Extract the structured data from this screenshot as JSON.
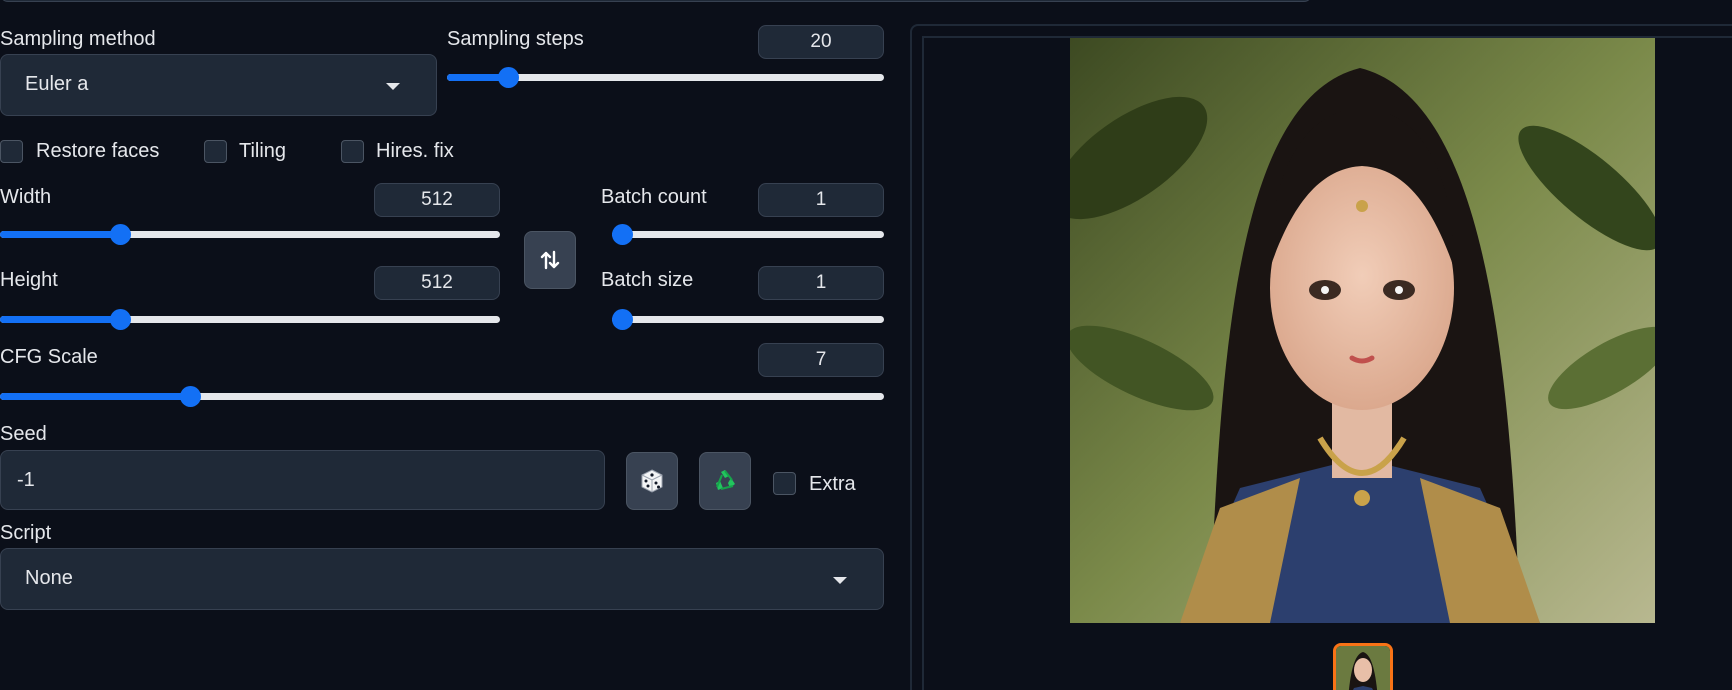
{
  "sampling": {
    "method_label": "Sampling method",
    "method_value": "Euler a",
    "steps_label": "Sampling steps",
    "steps_value": "20",
    "steps_fraction": 0.14
  },
  "checkboxes": {
    "restore_faces": "Restore faces",
    "tiling": "Tiling",
    "hires_fix": "Hires. fix"
  },
  "width": {
    "label": "Width",
    "value": "512",
    "fraction": 0.24
  },
  "height": {
    "label": "Height",
    "value": "512",
    "fraction": 0.24
  },
  "batch_count": {
    "label": "Batch count",
    "value": "1",
    "fraction": 0.0
  },
  "batch_size": {
    "label": "Batch size",
    "value": "1",
    "fraction": 0.0
  },
  "swap_icon": "swap-vertical-icon",
  "cfg": {
    "label": "CFG Scale",
    "value": "7",
    "fraction": 0.215
  },
  "seed": {
    "label": "Seed",
    "value": "-1",
    "dice_icon": "dice-icon",
    "recycle_icon": "recycle-icon",
    "extra_label": "Extra"
  },
  "script": {
    "label": "Script",
    "value": "None"
  },
  "colors": {
    "accent": "#1370f5",
    "background": "#0b0f19",
    "panel": "#1f2937",
    "thumb_border": "#f97316",
    "recycle": "#22c55e"
  }
}
